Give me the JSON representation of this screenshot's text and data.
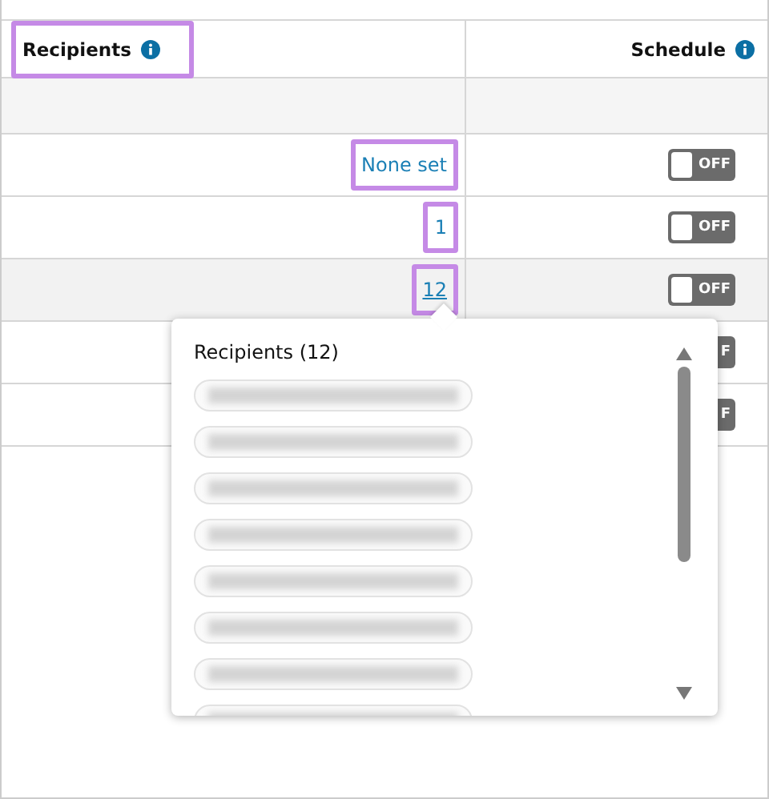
{
  "table": {
    "columns": [
      {
        "label": "Recipients",
        "highlighted": true
      },
      {
        "label": "Schedule",
        "highlighted": false
      }
    ],
    "rows": [
      {
        "recipients": "None set",
        "highlighted": true,
        "selected": false,
        "schedule": {
          "on": false,
          "label": "OFF"
        }
      },
      {
        "recipients": "1",
        "highlighted": true,
        "selected": false,
        "schedule": {
          "on": false,
          "label": "OFF"
        }
      },
      {
        "recipients": "12",
        "highlighted": true,
        "selected": true,
        "schedule": {
          "on": false,
          "label": "OFF"
        }
      },
      {
        "selected": false,
        "schedule": {
          "on": false,
          "label": "F"
        }
      },
      {
        "selected": false,
        "schedule": {
          "on": false,
          "label": "F"
        }
      }
    ]
  },
  "popover": {
    "title": "Recipients (12)",
    "items": [
      {
        "kind": "redacted"
      },
      {
        "kind": "redacted"
      },
      {
        "kind": "redacted"
      },
      {
        "kind": "redacted"
      },
      {
        "kind": "redacted"
      },
      {
        "kind": "redacted"
      },
      {
        "kind": "redacted"
      },
      {
        "kind": "redacted"
      }
    ]
  }
}
